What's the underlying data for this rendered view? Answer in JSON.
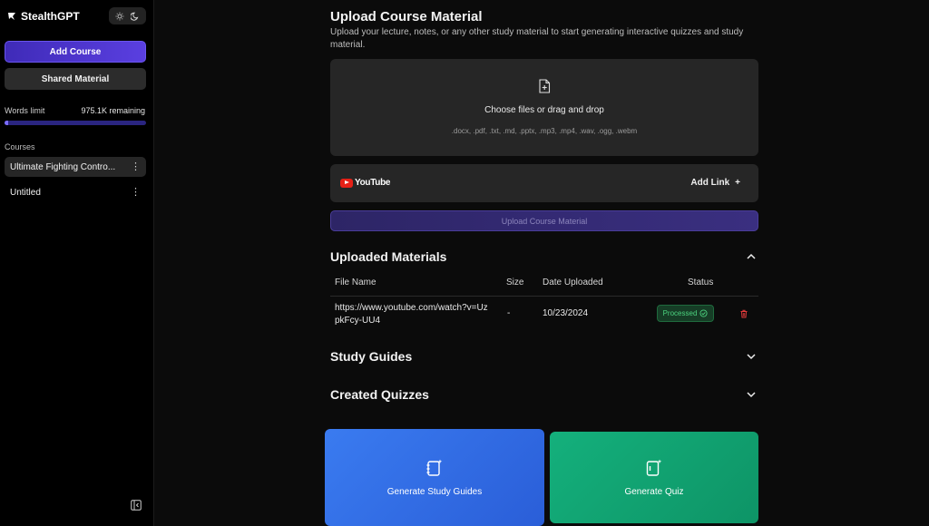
{
  "sidebar": {
    "brand": "StealthGPT",
    "add_course": "Add Course",
    "shared_material": "Shared Material",
    "words_limit_label": "Words limit",
    "words_remaining": "975.1K remaining",
    "words_used_fraction": 0.025,
    "courses_label": "Courses",
    "courses": [
      {
        "name": "Ultimate Fighting Contro...",
        "active": true
      },
      {
        "name": "Untitled",
        "active": false
      }
    ],
    "icons": {
      "sun": "sun-icon",
      "moon": "moon-icon",
      "collapse": "sidebar-collapse-icon",
      "more": "more-vertical-icon"
    }
  },
  "upload": {
    "title": "Upload Course Material",
    "subtitle": "Upload your lecture, notes, or any other study material to start generating interactive quizzes and study material.",
    "dropzone_title": "Choose files or drag and drop",
    "dropzone_types": ".docx, .pdf, .txt, .md, .pptx, .mp3, .mp4, .wav, .ogg, .webm",
    "youtube_label": "YouTube",
    "add_link": "Add Link",
    "add_link_icon": "+",
    "upload_button": "Upload Course Material"
  },
  "materials": {
    "title": "Uploaded Materials",
    "columns": [
      "File Name",
      "Size",
      "Date Uploaded",
      "Status"
    ],
    "rows": [
      {
        "file_name": "https://www.youtube.com/watch?v=UzpkFcy-UU4",
        "size": "-",
        "date": "10/23/2024",
        "status": "Processed"
      }
    ]
  },
  "study_guides": {
    "title": "Study Guides"
  },
  "quizzes": {
    "title": "Created Quizzes"
  },
  "actions": {
    "generate_study_guides": "Generate Study Guides",
    "generate_quiz": "Generate Quiz"
  },
  "colors": {
    "accent": "#5a3fe0",
    "study_card": "#3a7bf0",
    "quiz_card": "#14b07c",
    "status_ok": "#4cd37f",
    "delete": "#e23b3b"
  }
}
